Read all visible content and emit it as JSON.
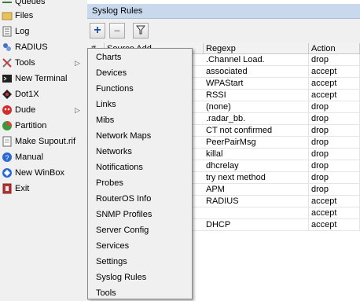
{
  "left_menu": {
    "items": [
      {
        "label": "Queues",
        "arrow": false
      },
      {
        "label": "Files",
        "arrow": false
      },
      {
        "label": "Log",
        "arrow": false
      },
      {
        "label": "RADIUS",
        "arrow": false
      },
      {
        "label": "Tools",
        "arrow": true
      },
      {
        "label": "New Terminal",
        "arrow": false
      },
      {
        "label": "Dot1X",
        "arrow": false
      },
      {
        "label": "Dude",
        "arrow": true
      },
      {
        "label": "Partition",
        "arrow": false
      },
      {
        "label": "Make Supout.rif",
        "arrow": false
      },
      {
        "label": "Manual",
        "arrow": false
      },
      {
        "label": "New WinBox",
        "arrow": false
      },
      {
        "label": "Exit",
        "arrow": false
      }
    ],
    "arrow_glyph": "▷"
  },
  "window": {
    "title": "Syslog Rules",
    "toolbar": {
      "add_label": "+",
      "remove_label": "−"
    }
  },
  "table": {
    "columns": [
      "#",
      "Source Address",
      "Regexp",
      "Action"
    ],
    "header_visible": [
      "#",
      "Source Add",
      "Regexp",
      "Action"
    ],
    "rows": [
      {
        "regexp": ".Channel Load.",
        "action": "drop"
      },
      {
        "regexp": "associated",
        "action": "accept"
      },
      {
        "regexp": "WPAStart",
        "action": "accept"
      },
      {
        "regexp": "RSSI",
        "action": "accept"
      },
      {
        "regexp": "(none)",
        "action": "drop"
      },
      {
        "regexp": ".radar_bb.",
        "action": "drop"
      },
      {
        "regexp": "CT not confirmed",
        "action": "drop"
      },
      {
        "regexp": "PeerPairMsg",
        "action": "drop"
      },
      {
        "regexp": "killal",
        "action": "drop"
      },
      {
        "regexp": "dhcrelay",
        "action": "drop"
      },
      {
        "regexp": "try next method",
        "action": "drop"
      },
      {
        "regexp": "APM",
        "action": "drop"
      },
      {
        "regexp": "RADIUS",
        "action": "accept"
      },
      {
        "regexp": "",
        "action": "accept"
      },
      {
        "regexp": "DHCP",
        "action": "accept"
      }
    ]
  },
  "popup_menu": {
    "items": [
      "Charts",
      "Devices",
      "Functions",
      "Links",
      "Mibs",
      "Network Maps",
      "Networks",
      "Notifications",
      "Probes",
      "RouterOS Info",
      "SNMP Profiles",
      "Server Config",
      "Services",
      "Settings",
      "Syslog Rules",
      "Tools"
    ]
  },
  "colors": {
    "title_bar": "#c8d9ee",
    "menu_bg": "#f0f0f0",
    "add_icon": "#1a4fa8"
  }
}
